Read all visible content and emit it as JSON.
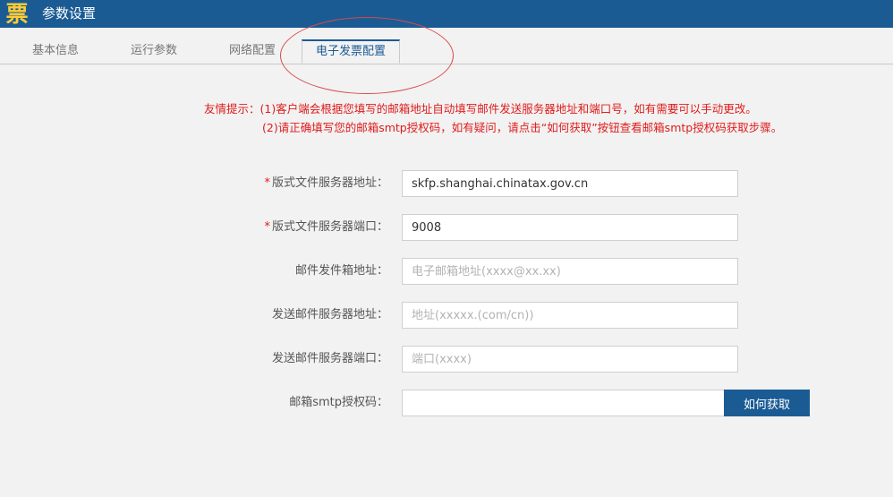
{
  "app": {
    "logo_char": "票",
    "title": "参数设置"
  },
  "tabs": [
    {
      "label": "基本信息",
      "active": false
    },
    {
      "label": "运行参数",
      "active": false
    },
    {
      "label": "网络配置",
      "active": false
    },
    {
      "label": "电子发票配置",
      "active": true
    }
  ],
  "tips": {
    "line1": "友情提示：(1)客户端会根据您填写的邮箱地址自动填写邮件发送服务器地址和端口号，如有需要可以手动更改。",
    "line2": "(2)请正确填写您的邮箱smtp授权码，如有疑问，请点击“如何获取”按钮查看邮箱smtp授权码获取步骤。"
  },
  "form": {
    "required_mark": "*",
    "layout_file_server_addr": {
      "label": "版式文件服务器地址：",
      "value": "skfp.shanghai.chinatax.gov.cn",
      "placeholder": ""
    },
    "layout_file_server_port": {
      "label": "版式文件服务器端口：",
      "value": "9008",
      "placeholder": ""
    },
    "mail_sender": {
      "label": "邮件发件箱地址：",
      "value": "",
      "placeholder": "电子邮箱地址(xxxx@xx.xx)"
    },
    "smtp_server_addr": {
      "label": "发送邮件服务器地址：",
      "value": "",
      "placeholder": "地址(xxxxx.(com/cn))"
    },
    "smtp_server_port": {
      "label": "发送邮件服务器端口：",
      "value": "",
      "placeholder": "端口(xxxx)"
    },
    "smtp_auth_code": {
      "label": "邮箱smtp授权码：",
      "value": "",
      "placeholder": ""
    },
    "how_to_get_button": "如何获取"
  },
  "colors": {
    "header": "#1b5b94",
    "accent": "#1b5b94",
    "warning": "#e01b1b",
    "annotation_circle": "#d94a4a"
  }
}
